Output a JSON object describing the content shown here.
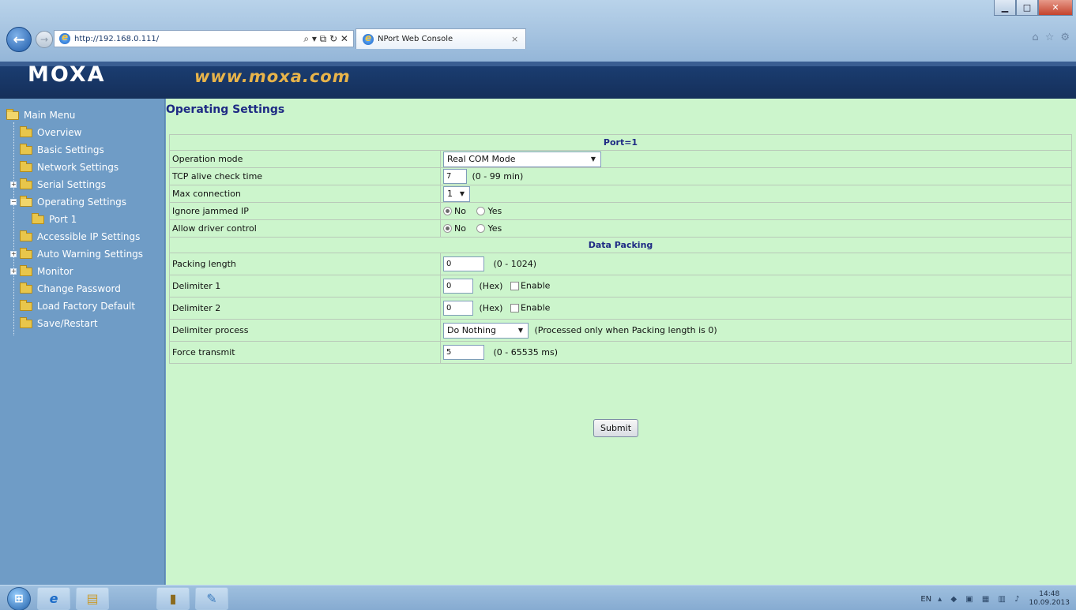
{
  "browser": {
    "url": "http://192.168.0.111/",
    "tab_title": "NPort Web Console",
    "address_tools": "⌕ ▾ ⧉ ↻ ✕",
    "min_glyph": "▁",
    "max_glyph": "□",
    "close_glyph": "✕",
    "tab_close_glyph": "×"
  },
  "banner": {
    "logo": "MOXA",
    "website": "www.moxa.com"
  },
  "sidebar": {
    "root": "Main Menu",
    "items": [
      {
        "label": "Overview"
      },
      {
        "label": "Basic Settings"
      },
      {
        "label": "Network Settings"
      },
      {
        "label": "Serial Settings"
      },
      {
        "label": "Operating Settings"
      },
      {
        "label": "Port 1"
      },
      {
        "label": "Accessible IP Settings"
      },
      {
        "label": "Auto Warning Settings"
      },
      {
        "label": "Monitor"
      },
      {
        "label": "Change Password"
      },
      {
        "label": "Load Factory Default"
      },
      {
        "label": "Save/Restart"
      }
    ]
  },
  "main": {
    "title": "Operating Settings",
    "port_header": "Port=1",
    "data_packing_header": "Data Packing",
    "rows": {
      "operation_mode": {
        "label": "Operation mode",
        "value": "Real COM Mode"
      },
      "tcp_alive": {
        "label": "TCP alive check time",
        "value": "7",
        "hint": "(0 - 99 min)"
      },
      "max_connection": {
        "label": "Max connection",
        "value": "1"
      },
      "ignore_jammed": {
        "label": "Ignore jammed IP",
        "opt_no": "No",
        "opt_yes": "Yes",
        "selected": "No"
      },
      "allow_driver": {
        "label": "Allow driver control",
        "opt_no": "No",
        "opt_yes": "Yes",
        "selected": "No"
      },
      "packing_length": {
        "label": "Packing length",
        "value": "0",
        "hint": "(0 - 1024)"
      },
      "delimiter1": {
        "label": "Delimiter 1",
        "value": "0",
        "hex": "(Hex)",
        "enable": "Enable",
        "checked": false
      },
      "delimiter2": {
        "label": "Delimiter 2",
        "value": "0",
        "hex": "(Hex)",
        "enable": "Enable",
        "checked": false
      },
      "delimiter_process": {
        "label": "Delimiter process",
        "value": "Do Nothing",
        "hint": "(Processed only when Packing length is 0)"
      },
      "force_transmit": {
        "label": "Force transmit",
        "value": "5",
        "hint": "(0 - 65535 ms)"
      }
    },
    "submit": "Submit"
  },
  "taskbar": {
    "lang": "EN",
    "time": "14:48",
    "date": "10.09.2013"
  }
}
